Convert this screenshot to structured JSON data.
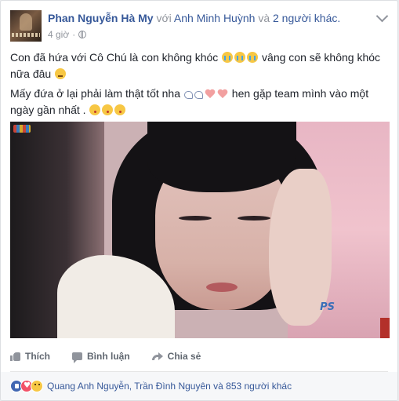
{
  "post": {
    "author": "Phan Nguyễn Hà My",
    "with_text": "với",
    "tagged": "Anh Minh Huỳnh",
    "and_text": "và",
    "others": "2 người khác.",
    "time": "4 giờ",
    "privacy_separator": "·",
    "line1_a": "Con đã hứa với Cô Chú là con không khóc",
    "line1_b": "vâng con sẽ không khóc nữa đâu",
    "line2_a": "Mấy đứa ở lại phải làm thật tốt nha",
    "line2_b": "hen gặp team mình vào một ngày gần nhất .",
    "watermark": "PS"
  },
  "actions": {
    "like": "Thích",
    "comment": "Bình luận",
    "share": "Chia sẻ"
  },
  "reactions": {
    "summary": "Quang Anh Nguyễn, Trần Đình Nguyên và 853 người khác",
    "types": [
      "like",
      "love",
      "sad"
    ]
  },
  "colors": {
    "link": "#365899",
    "muted": "#90949c",
    "like_blue": "#4267b2",
    "love_red": "#f25268"
  }
}
